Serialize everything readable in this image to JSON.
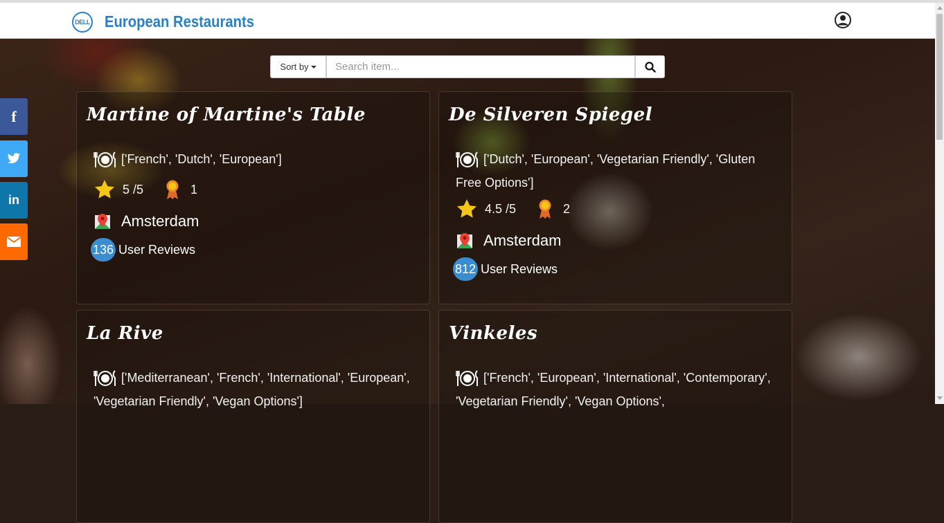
{
  "header": {
    "logo_text": "DELL",
    "brand": "European Restaurants",
    "user_icon": "user-circle-icon"
  },
  "search": {
    "sort_label": "Sort by",
    "placeholder": "Search item...",
    "value": "",
    "button_icon": "search-icon"
  },
  "social": [
    {
      "name": "facebook",
      "glyph": "f",
      "color": "#3b5998"
    },
    {
      "name": "twitter",
      "glyph": "twitter-icon",
      "color": "#3fa9f5"
    },
    {
      "name": "linkedin",
      "glyph": "in",
      "color": "#0e76a8"
    },
    {
      "name": "email",
      "glyph": "envelope-icon",
      "color": "#ff6a00"
    }
  ],
  "restaurants": [
    {
      "name": "Martine of Martine's Table",
      "cuisines": "['French', 'Dutch', 'European']",
      "rating": "5 /5",
      "awards": "1",
      "city": "Amsterdam",
      "review_count": "136",
      "reviews_label": "User Reviews"
    },
    {
      "name": "De Silveren Spiegel",
      "cuisines": "['Dutch', 'European', 'Vegetarian Friendly', 'Gluten Free Options']",
      "rating": "4.5 /5",
      "awards": "2",
      "city": "Amsterdam",
      "review_count": "812",
      "reviews_label": "User Reviews"
    },
    {
      "name": "La Rive",
      "cuisines": "['Mediterranean', 'French', 'International', 'European', 'Vegetarian Friendly', 'Vegan Options']"
    },
    {
      "name": "Vinkeles",
      "cuisines": "['French', 'European', 'International', 'Contemporary', 'Vegetarian Friendly', 'Vegan Options',"
    }
  ]
}
